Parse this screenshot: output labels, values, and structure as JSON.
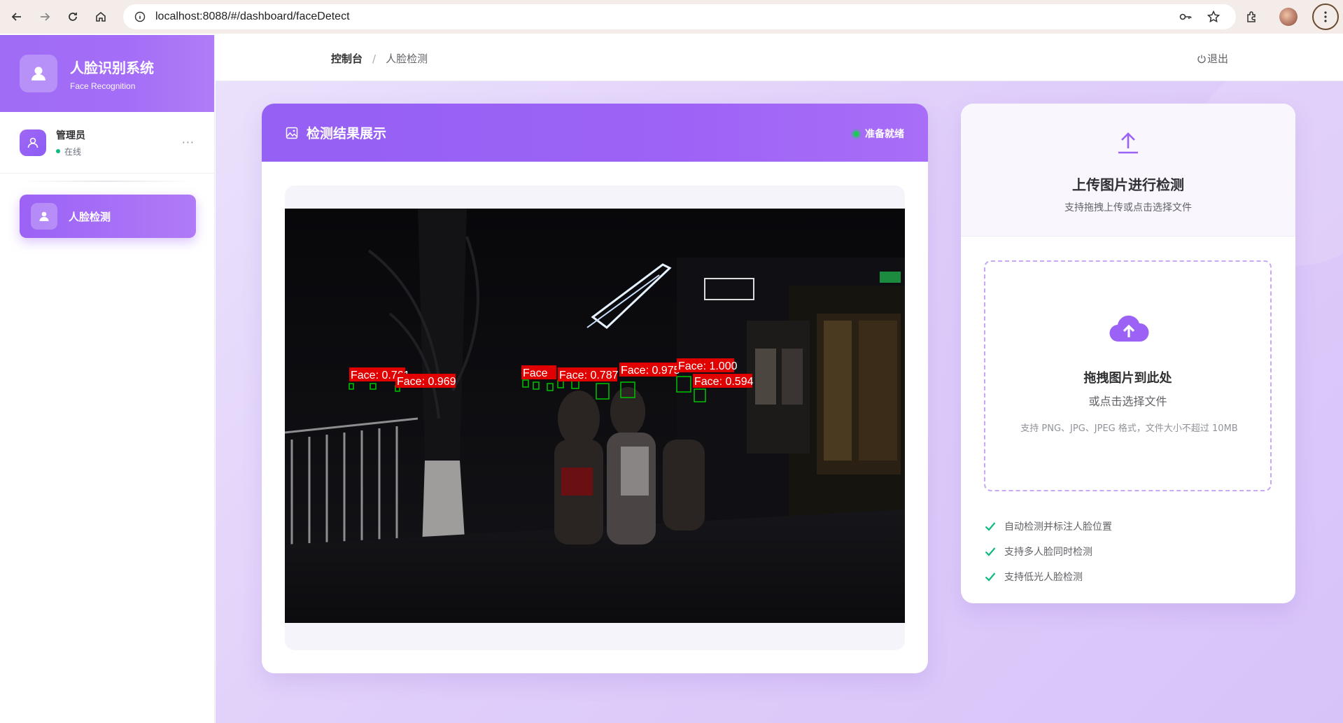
{
  "browser": {
    "url": "localhost:8088/#/dashboard/faceDetect"
  },
  "sidebar": {
    "brand_title": "人脸识别系统",
    "brand_subtitle": "Face Recognition",
    "user_name": "管理员",
    "user_status": "在线",
    "user_more": "···",
    "menu": [
      {
        "label": "人脸检测",
        "active": true
      }
    ]
  },
  "topbar": {
    "breadcrumb": [
      "控制台",
      "人脸检测"
    ],
    "breadcrumb_sep": "/",
    "logout": "退出"
  },
  "result_card": {
    "title": "检测结果展示",
    "status": "准备就绪",
    "detections": [
      {
        "label": "Face: 0.761"
      },
      {
        "label": "Face: 0.969"
      },
      {
        "label": "Face"
      },
      {
        "label": "Face: 0.787"
      },
      {
        "label": "Face: 0.975"
      },
      {
        "label": "Face: 1.000"
      },
      {
        "label": "Face: 0.594"
      }
    ]
  },
  "upload_card": {
    "title": "上传图片进行检测",
    "subtitle": "支持拖拽上传或点击选择文件",
    "drop_title": "拖拽图片到此处",
    "drop_subtitle": "或点击选择文件",
    "drop_hint": "支持 PNG、JPG、JPEG 格式，文件大小不超过 10MB",
    "features": [
      "自动检测并标注人脸位置",
      "支持多人脸同时检测",
      "支持低光人脸检测"
    ]
  },
  "colors": {
    "accent": "#9b62f5",
    "status_green": "#22c55e",
    "check_green": "#10b981",
    "detection_box": "#00c400",
    "detection_label_bg": "#e00000"
  }
}
